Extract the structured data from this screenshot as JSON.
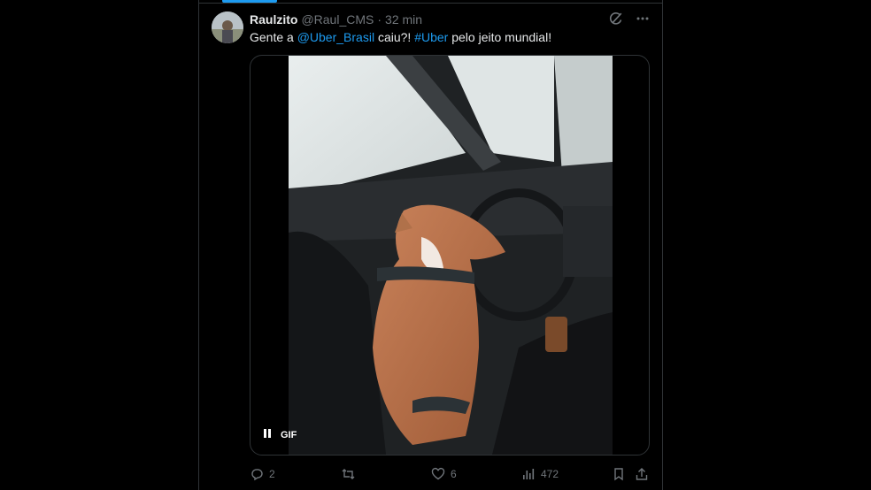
{
  "tweet": {
    "display_name": "Raulzito",
    "handle": "@Raul_CMS",
    "separator": "·",
    "time": "32 min",
    "text_prefix": "Gente a ",
    "mention": "@Uber_Brasil",
    "text_middle": " caiu?! ",
    "hashtag": "#Uber",
    "text_suffix": " pelo jeito mundial!"
  },
  "media": {
    "badge": "GIF",
    "state": "playing"
  },
  "actions": {
    "replies": "2",
    "reposts": "",
    "likes": "6",
    "views": "472"
  },
  "colors": {
    "background": "#000000",
    "text": "#e7e9ea",
    "secondary": "#71767b",
    "link": "#1d9bf0",
    "border": "#2f3336"
  },
  "icons": [
    "grok-icon",
    "more-icon",
    "pause-icon",
    "reply-icon",
    "repost-icon",
    "like-icon",
    "views-icon",
    "bookmark-icon",
    "share-icon"
  ]
}
